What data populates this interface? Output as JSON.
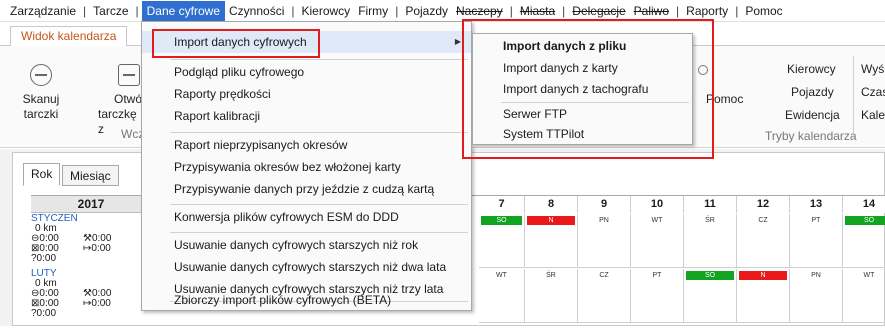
{
  "menubar": {
    "items": [
      "Zarządzanie",
      "Tarcze",
      "Dane cyfrowe",
      "Czynności",
      "Kierowcy",
      "Firmy",
      "Pojazdy",
      "Naczepy",
      "Miasta",
      "Delegacje",
      "Paliwo",
      "Raporty",
      "Pomoc"
    ]
  },
  "ribbon": {
    "tab": "Widok kalendarza",
    "buttons": [
      {
        "label1": "Skanuj",
        "label2": "tarczki"
      },
      {
        "label1": "Otwó",
        "label2": "tarczkę z"
      }
    ],
    "group_fragment": "Wcz",
    "pomoc_fragment": "Pomoc",
    "calendar_modes": [
      "Kierowcy",
      "Pojazdy",
      "Ewidencja"
    ],
    "calendar_modes_label": "Tryby kalendarza",
    "right_cut": [
      "Wyś",
      "Czas",
      "Kale"
    ]
  },
  "calendar": {
    "tabs": [
      "Rok",
      "Miesiąc"
    ],
    "year": "2017",
    "months": [
      {
        "name": "STYCZEŃ",
        "km": "0 km",
        "r1a": "⊖0:00",
        "r1b": "⚒0:00",
        "r2a": "⊠0:00",
        "r2b": "↦0:00",
        "r3": "?0:00"
      },
      {
        "name": "LUTY",
        "km": "0 km",
        "r1a": "⊖0:00",
        "r1b": "⚒0:00",
        "r2a": "⊠0:00",
        "r2b": "↦0:00",
        "r3": "?0:00"
      }
    ],
    "day_numbers": [
      "7",
      "8",
      "9",
      "10",
      "11",
      "12",
      "13",
      "14"
    ],
    "weekdays_row1": [
      "SO",
      "N",
      "PN",
      "WT",
      "ŚR",
      "CZ",
      "PT",
      "SO"
    ],
    "weekdays_row2": [
      "WT",
      "ŚR",
      "CZ",
      "PT",
      "SO",
      "N",
      "PN",
      "WT"
    ]
  },
  "dropdown": {
    "items": [
      "Import danych cyfrowych",
      "Podgląd pliku cyfrowego",
      "Raporty prędkości",
      "Raport kalibracji",
      "Raport nieprzypisanych okresów",
      "Przypisywania okresów bez włożonej karty",
      "Przypisywanie danych przy jeździe z cudzą kartą",
      "Konwersja plików cyfrowych ESM do DDD",
      "Usuwanie danych cyfrowych starszych niż rok",
      "Usuwanie danych cyfrowych starszych niż dwa lata",
      "Usuwanie danych cyfrowych starszych niż trzy lata",
      "Zbiorczy import plików cyfrowych (BETA)"
    ]
  },
  "submenu": {
    "items": [
      "Import danych z pliku",
      "Import danych z karty",
      "Import danych z tachografu",
      "Serwer FTP",
      "System TTPilot"
    ]
  },
  "colors": {
    "menu_active": "#2e6fcf",
    "highlight": "#dfe9f7",
    "callout_red": "#e21b1b",
    "day_green": "#11a421",
    "day_red": "#e81a1a",
    "tab_orange": "#c7551a",
    "month_blue": "#1f5fc5"
  }
}
